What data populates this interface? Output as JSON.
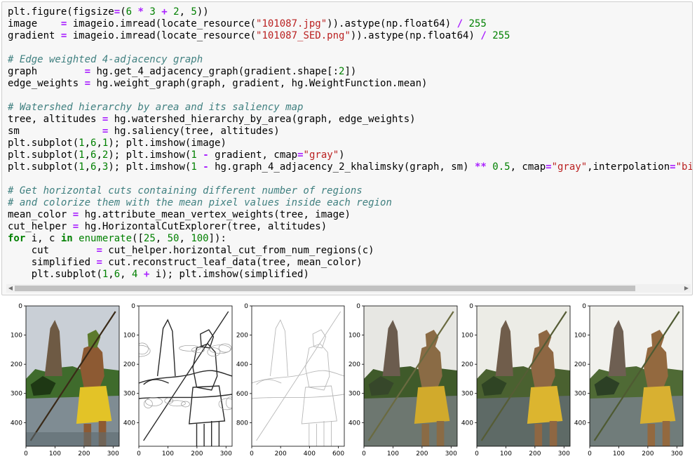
{
  "code_lines": [
    [
      {
        "t": "plt",
        "c": ""
      },
      {
        "t": ".",
        "c": ""
      },
      {
        "t": "figure(figsize",
        "c": ""
      },
      {
        "t": "=",
        "c": "op"
      },
      {
        "t": "(",
        "c": ""
      },
      {
        "t": "6",
        "c": "num"
      },
      {
        "t": " ",
        "c": ""
      },
      {
        "t": "*",
        "c": "op"
      },
      {
        "t": " ",
        "c": ""
      },
      {
        "t": "3",
        "c": "num"
      },
      {
        "t": " ",
        "c": ""
      },
      {
        "t": "+",
        "c": "op"
      },
      {
        "t": " ",
        "c": ""
      },
      {
        "t": "2",
        "c": "num"
      },
      {
        "t": ", ",
        "c": ""
      },
      {
        "t": "5",
        "c": "num"
      },
      {
        "t": "))",
        "c": ""
      }
    ],
    [
      {
        "t": "image    ",
        "c": ""
      },
      {
        "t": "=",
        "c": "op"
      },
      {
        "t": " imageio.imread(locate_resource(",
        "c": ""
      },
      {
        "t": "\"101087.jpg\"",
        "c": "st"
      },
      {
        "t": ")).astype(np.float64) ",
        "c": ""
      },
      {
        "t": "/",
        "c": "op"
      },
      {
        "t": " ",
        "c": ""
      },
      {
        "t": "255",
        "c": "num"
      }
    ],
    [
      {
        "t": "gradient ",
        "c": ""
      },
      {
        "t": "=",
        "c": "op"
      },
      {
        "t": " imageio.imread(locate_resource(",
        "c": ""
      },
      {
        "t": "\"101087_SED.png\"",
        "c": "st"
      },
      {
        "t": ")).astype(np.float64) ",
        "c": ""
      },
      {
        "t": "/",
        "c": "op"
      },
      {
        "t": " ",
        "c": ""
      },
      {
        "t": "255",
        "c": "num"
      }
    ],
    [],
    [
      {
        "t": "# Edge weighted 4-adjacency graph",
        "c": "cm"
      }
    ],
    [
      {
        "t": "graph        ",
        "c": ""
      },
      {
        "t": "=",
        "c": "op"
      },
      {
        "t": " hg.get_4_adjacency_graph(gradient.shape[:",
        "c": ""
      },
      {
        "t": "2",
        "c": "num"
      },
      {
        "t": "])",
        "c": ""
      }
    ],
    [
      {
        "t": "edge_weights ",
        "c": ""
      },
      {
        "t": "=",
        "c": "op"
      },
      {
        "t": " hg.weight_graph(graph, gradient, hg.WeightFunction.mean)",
        "c": ""
      }
    ],
    [],
    [
      {
        "t": "# Watershed hierarchy by area and its saliency map",
        "c": "cm"
      }
    ],
    [
      {
        "t": "tree, altitudes ",
        "c": ""
      },
      {
        "t": "=",
        "c": "op"
      },
      {
        "t": " hg.watershed_hierarchy_by_area(graph, edge_weights)",
        "c": ""
      }
    ],
    [
      {
        "t": "sm              ",
        "c": ""
      },
      {
        "t": "=",
        "c": "op"
      },
      {
        "t": " hg.saliency(tree, altitudes)",
        "c": ""
      }
    ],
    [
      {
        "t": "plt.subplot(",
        "c": ""
      },
      {
        "t": "1",
        "c": "num"
      },
      {
        "t": ",",
        "c": ""
      },
      {
        "t": "6",
        "c": "num"
      },
      {
        "t": ",",
        "c": ""
      },
      {
        "t": "1",
        "c": "num"
      },
      {
        "t": "); plt.imshow(image)",
        "c": ""
      }
    ],
    [
      {
        "t": "plt.subplot(",
        "c": ""
      },
      {
        "t": "1",
        "c": "num"
      },
      {
        "t": ",",
        "c": ""
      },
      {
        "t": "6",
        "c": "num"
      },
      {
        "t": ",",
        "c": ""
      },
      {
        "t": "2",
        "c": "num"
      },
      {
        "t": "); plt.imshow(",
        "c": ""
      },
      {
        "t": "1",
        "c": "num"
      },
      {
        "t": " ",
        "c": ""
      },
      {
        "t": "-",
        "c": "op"
      },
      {
        "t": " gradient, cmap",
        "c": ""
      },
      {
        "t": "=",
        "c": "op"
      },
      {
        "t": "\"gray\"",
        "c": "st"
      },
      {
        "t": ")",
        "c": ""
      }
    ],
    [
      {
        "t": "plt.subplot(",
        "c": ""
      },
      {
        "t": "1",
        "c": "num"
      },
      {
        "t": ",",
        "c": ""
      },
      {
        "t": "6",
        "c": "num"
      },
      {
        "t": ",",
        "c": ""
      },
      {
        "t": "3",
        "c": "num"
      },
      {
        "t": "); plt.imshow(",
        "c": ""
      },
      {
        "t": "1",
        "c": "num"
      },
      {
        "t": " ",
        "c": ""
      },
      {
        "t": "-",
        "c": "op"
      },
      {
        "t": " hg.graph_4_adjacency_2_khalimsky(graph, sm) ",
        "c": ""
      },
      {
        "t": "**",
        "c": "op"
      },
      {
        "t": " ",
        "c": ""
      },
      {
        "t": "0.5",
        "c": "num"
      },
      {
        "t": ", cmap",
        "c": ""
      },
      {
        "t": "=",
        "c": "op"
      },
      {
        "t": "\"gray\"",
        "c": "st"
      },
      {
        "t": ",interpolation",
        "c": ""
      },
      {
        "t": "=",
        "c": "op"
      },
      {
        "t": "\"bi",
        "c": "st"
      }
    ],
    [],
    [
      {
        "t": "# Get horizontal cuts containing different number of regions",
        "c": "cm"
      }
    ],
    [
      {
        "t": "# and colorize them with the mean pixel values inside each region",
        "c": "cm"
      }
    ],
    [
      {
        "t": "mean_color ",
        "c": ""
      },
      {
        "t": "=",
        "c": "op"
      },
      {
        "t": " hg.attribute_mean_vertex_weights(tree, image)",
        "c": ""
      }
    ],
    [
      {
        "t": "cut_helper ",
        "c": ""
      },
      {
        "t": "=",
        "c": "op"
      },
      {
        "t": " hg.HorizontalCutExplorer(tree, altitudes)",
        "c": ""
      }
    ],
    [
      {
        "t": "for",
        "c": "kw"
      },
      {
        "t": " i, c ",
        "c": ""
      },
      {
        "t": "in",
        "c": "kw"
      },
      {
        "t": " ",
        "c": ""
      },
      {
        "t": "enumerate",
        "c": "nb"
      },
      {
        "t": "([",
        "c": ""
      },
      {
        "t": "25",
        "c": "num"
      },
      {
        "t": ", ",
        "c": ""
      },
      {
        "t": "50",
        "c": "num"
      },
      {
        "t": ", ",
        "c": ""
      },
      {
        "t": "100",
        "c": "num"
      },
      {
        "t": "]):",
        "c": ""
      }
    ],
    [
      {
        "t": "    cut        ",
        "c": ""
      },
      {
        "t": "=",
        "c": "op"
      },
      {
        "t": " cut_helper.horizontal_cut_from_num_regions(c)",
        "c": ""
      }
    ],
    [
      {
        "t": "    simplified ",
        "c": ""
      },
      {
        "t": "=",
        "c": "op"
      },
      {
        "t": " cut.reconstruct_leaf_data(tree, mean_color)",
        "c": ""
      }
    ],
    [
      {
        "t": "    plt.subplot(",
        "c": ""
      },
      {
        "t": "1",
        "c": "num"
      },
      {
        "t": ",",
        "c": ""
      },
      {
        "t": "6",
        "c": "num"
      },
      {
        "t": ", ",
        "c": ""
      },
      {
        "t": "4",
        "c": "num"
      },
      {
        "t": " ",
        "c": ""
      },
      {
        "t": "+",
        "c": "op"
      },
      {
        "t": " i); plt.imshow(simplified)",
        "c": ""
      }
    ]
  ],
  "scrollbar": {
    "thumb_start_fraction": 0.0,
    "thumb_end_fraction": 0.93
  },
  "plots": [
    {
      "id": "original-photo",
      "style": "photo",
      "x_ticks": [
        "0",
        "100",
        "200",
        "300"
      ],
      "y_ticks": [
        "0",
        "100",
        "200",
        "300",
        "400"
      ],
      "x_vals": [
        0,
        100,
        200,
        300
      ],
      "y_vals": [
        0,
        100,
        200,
        300,
        400
      ],
      "x_max": 321,
      "y_max": 481
    },
    {
      "id": "gradient-map",
      "style": "gradient",
      "x_ticks": [
        "0",
        "100",
        "200",
        "300"
      ],
      "y_ticks": [
        "0",
        "100",
        "200",
        "300",
        "400"
      ],
      "x_vals": [
        0,
        100,
        200,
        300
      ],
      "y_vals": [
        0,
        100,
        200,
        300,
        400
      ],
      "x_max": 321,
      "y_max": 481
    },
    {
      "id": "saliency-map",
      "style": "saliency",
      "x_ticks": [
        "0",
        "200",
        "400",
        "600"
      ],
      "y_ticks": [
        "0",
        "200",
        "400",
        "600",
        "800"
      ],
      "x_vals": [
        0,
        200,
        400,
        600
      ],
      "y_vals": [
        0,
        200,
        400,
        600,
        800
      ],
      "x_max": 641,
      "y_max": 961
    },
    {
      "id": "cut-25-regions",
      "style": "cut25",
      "x_ticks": [
        "0",
        "100",
        "200",
        "300"
      ],
      "y_ticks": [
        "0",
        "100",
        "200",
        "300",
        "400"
      ],
      "x_vals": [
        0,
        100,
        200,
        300
      ],
      "y_vals": [
        0,
        100,
        200,
        300,
        400
      ],
      "x_max": 321,
      "y_max": 481
    },
    {
      "id": "cut-50-regions",
      "style": "cut50",
      "x_ticks": [
        "0",
        "100",
        "200",
        "300"
      ],
      "y_ticks": [
        "0",
        "100",
        "200",
        "300",
        "400"
      ],
      "x_vals": [
        0,
        100,
        200,
        300
      ],
      "y_vals": [
        0,
        100,
        200,
        300,
        400
      ],
      "x_max": 321,
      "y_max": 481
    },
    {
      "id": "cut-100-regions",
      "style": "cut100",
      "x_ticks": [
        "0",
        "100",
        "200",
        "300"
      ],
      "y_ticks": [
        "0",
        "100",
        "200",
        "300",
        "400"
      ],
      "x_vals": [
        0,
        100,
        200,
        300
      ],
      "y_vals": [
        0,
        100,
        200,
        300,
        400
      ],
      "x_max": 321,
      "y_max": 481
    }
  ]
}
